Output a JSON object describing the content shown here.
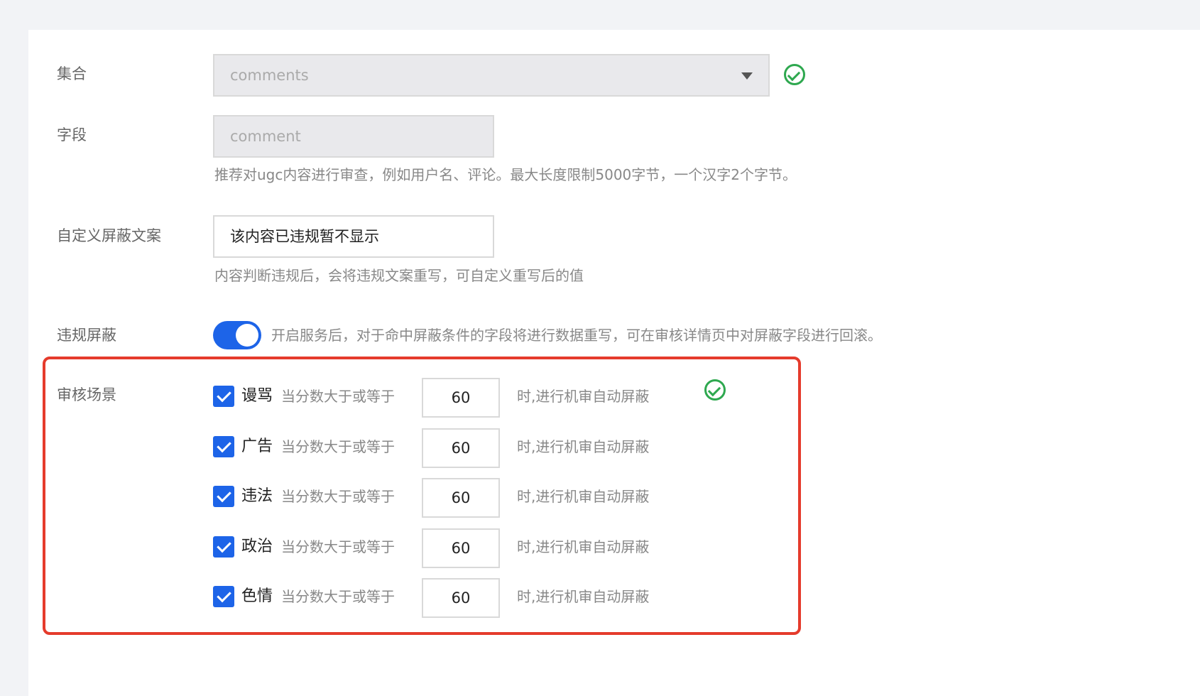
{
  "form": {
    "collection": {
      "label": "集合",
      "value": "comments"
    },
    "field": {
      "label": "字段",
      "value": "comment",
      "hint": "推荐对ugc内容进行审查，例如用户名、评论。最大长度限制5000字节，一个汉字2个字节。"
    },
    "custom_text": {
      "label": "自定义屏蔽文案",
      "value": "该内容已违规暂不显示",
      "hint": "内容判断违规后，会将违规文案重写，可自定义重写后的值"
    },
    "violation_block": {
      "label": "违规屏蔽",
      "enabled": true,
      "hint": "开启服务后，对于命中屏蔽条件的字段将进行数据重写，可在审核详情页中对屏蔽字段进行回滚。"
    },
    "scenes": {
      "label": "审核场景",
      "rows": [
        {
          "name": "谩骂",
          "checked": true,
          "prefix": "当分数大于或等于",
          "value": "60",
          "suffix": "时,进行机审自动屏蔽"
        },
        {
          "name": "广告",
          "checked": true,
          "prefix": "当分数大于或等于",
          "value": "60",
          "suffix": "时,进行机审自动屏蔽"
        },
        {
          "name": "违法",
          "checked": true,
          "prefix": "当分数大于或等于",
          "value": "60",
          "suffix": "时,进行机审自动屏蔽"
        },
        {
          "name": "政治",
          "checked": true,
          "prefix": "当分数大于或等于",
          "value": "60",
          "suffix": "时,进行机审自动屏蔽"
        },
        {
          "name": "色情",
          "checked": true,
          "prefix": "当分数大于或等于",
          "value": "60",
          "suffix": "时,进行机审自动屏蔽"
        }
      ]
    }
  },
  "icons": {
    "valid": "check-circle-icon",
    "select": "caret-down-icon",
    "checkbox": "checkmark-icon"
  },
  "colors": {
    "accent": "#1d64e8",
    "success": "#2ea84f",
    "highlight": "#e53b2c"
  }
}
